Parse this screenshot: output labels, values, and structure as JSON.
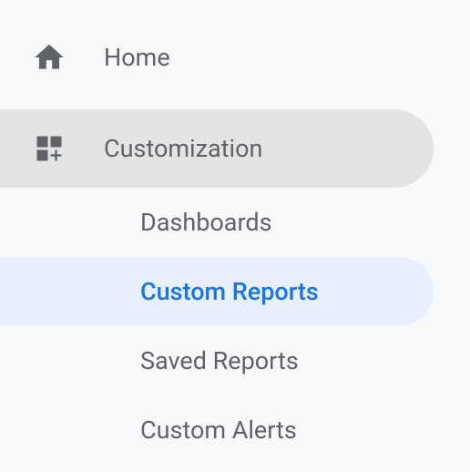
{
  "sidebar": {
    "home": {
      "label": "Home"
    },
    "customization": {
      "label": "Customization"
    },
    "submenu": {
      "dashboards": {
        "label": "Dashboards"
      },
      "custom_reports": {
        "label": "Custom Reports"
      },
      "saved_reports": {
        "label": "Saved Reports"
      },
      "custom_alerts": {
        "label": "Custom Alerts"
      }
    }
  }
}
